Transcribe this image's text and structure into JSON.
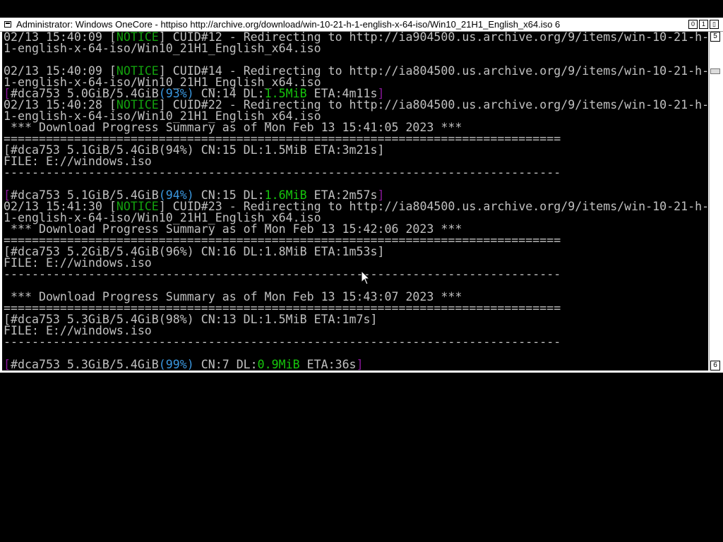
{
  "window": {
    "title": "Administrator:  Windows OneCore - httpiso  http://archive.org/download/win-10-21-h-1-english-x-64-iso/Win10_21H1_English_x64.iso 6",
    "buttons": [
      "0",
      "1",
      "▯"
    ]
  },
  "scrollbar": {
    "up_label": "5",
    "down_label": "6"
  },
  "lines": [
    [
      {
        "t": "02/13 15:40:09 ["
      },
      {
        "t": "NOTICE",
        "c": "green"
      },
      {
        "t": "] CUID#12 - Redirecting to http://ia904500.us.archive.org/9/items/win-10-21-h-"
      }
    ],
    [
      {
        "t": "1-english-x-64-iso/Win10_21H1_English_x64.iso"
      }
    ],
    [
      {
        "t": ""
      }
    ],
    [
      {
        "t": "02/13 15:40:09 ["
      },
      {
        "t": "NOTICE",
        "c": "green"
      },
      {
        "t": "] CUID#14 - Redirecting to http://ia804500.us.archive.org/9/items/win-10-21-h-"
      }
    ],
    [
      {
        "t": "1-english-x-64-iso/Win10_21H1_English_x64.iso"
      }
    ],
    [
      {
        "t": "[",
        "c": "mag"
      },
      {
        "t": "#dca753 5.0GiB/5.4GiB"
      },
      {
        "t": "(93%)",
        "c": "teal"
      },
      {
        "t": " CN:14 DL:"
      },
      {
        "t": "1.5MiB",
        "c": "lgreen"
      },
      {
        "t": " ETA:4m11s"
      },
      {
        "t": "]",
        "c": "mag"
      }
    ],
    [
      {
        "t": "02/13 15:40:28 ["
      },
      {
        "t": "NOTICE",
        "c": "green"
      },
      {
        "t": "] CUID#22 - Redirecting to http://ia804500.us.archive.org/9/items/win-10-21-h-"
      }
    ],
    [
      {
        "t": "1-english-x-64-iso/Win10_21H1_English_x64.iso"
      }
    ],
    [
      {
        "t": " *** Download Progress Summary as of Mon Feb 13 15:41:05 2023 ***"
      }
    ],
    [
      {
        "t": "==============================================================================="
      }
    ],
    [
      {
        "t": "[#dca753 5.1GiB/5.4GiB(94%) CN:15 DL:1.5MiB ETA:3m21s]"
      }
    ],
    [
      {
        "t": "FILE: E://windows.iso"
      }
    ],
    [
      {
        "t": "-------------------------------------------------------------------------------"
      }
    ],
    [
      {
        "t": ""
      }
    ],
    [
      {
        "t": "[",
        "c": "mag"
      },
      {
        "t": "#dca753 5.1GiB/5.4GiB"
      },
      {
        "t": "(94%)",
        "c": "teal"
      },
      {
        "t": " CN:15 DL:"
      },
      {
        "t": "1.6MiB",
        "c": "lgreen"
      },
      {
        "t": " ETA:2m57s"
      },
      {
        "t": "]",
        "c": "mag"
      }
    ],
    [
      {
        "t": "02/13 15:41:30 ["
      },
      {
        "t": "NOTICE",
        "c": "green"
      },
      {
        "t": "] CUID#23 - Redirecting to http://ia804500.us.archive.org/9/items/win-10-21-h-"
      }
    ],
    [
      {
        "t": "1-english-x-64-iso/Win10_21H1_English_x64.iso"
      }
    ],
    [
      {
        "t": " *** Download Progress Summary as of Mon Feb 13 15:42:06 2023 ***"
      }
    ],
    [
      {
        "t": "==============================================================================="
      }
    ],
    [
      {
        "t": "[#dca753 5.2GiB/5.4GiB(96%) CN:16 DL:1.8MiB ETA:1m53s]"
      }
    ],
    [
      {
        "t": "FILE: E://windows.iso"
      }
    ],
    [
      {
        "t": "-------------------------------------------------------------------------------"
      }
    ],
    [
      {
        "t": ""
      }
    ],
    [
      {
        "t": " *** Download Progress Summary as of Mon Feb 13 15:43:07 2023 ***"
      }
    ],
    [
      {
        "t": "==============================================================================="
      }
    ],
    [
      {
        "t": "[#dca753 5.3GiB/5.4GiB(98%) CN:13 DL:1.5MiB ETA:1m7s]"
      }
    ],
    [
      {
        "t": "FILE: E://windows.iso"
      }
    ],
    [
      {
        "t": "-------------------------------------------------------------------------------"
      }
    ],
    [
      {
        "t": ""
      }
    ],
    [
      {
        "t": "[",
        "c": "mag"
      },
      {
        "t": "#dca753 5.3GiB/5.4GiB"
      },
      {
        "t": "(99%)",
        "c": "teal"
      },
      {
        "t": " CN:7 DL:"
      },
      {
        "t": "0.9MiB",
        "c": "lgreen"
      },
      {
        "t": " ETA:36s"
      },
      {
        "t": "]",
        "c": "mag"
      }
    ]
  ],
  "colors": {
    "green": "#13a10e",
    "lgreen": "#16c60c",
    "teal": "#3a96dd",
    "mag": "#881798",
    "text": "#c0c0c0",
    "bg": "#000000"
  }
}
